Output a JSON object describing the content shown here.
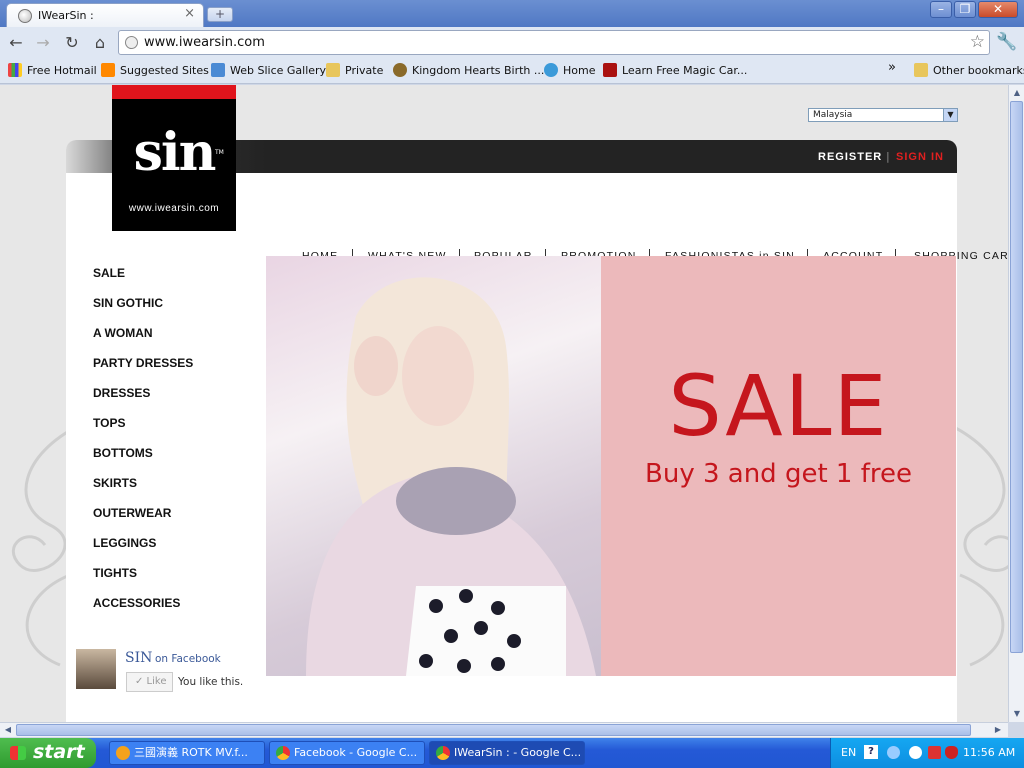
{
  "browser": {
    "tab_title": "IWearSin :",
    "tab_close": "×",
    "new_tab": "+",
    "window_buttons": {
      "minimize": "–",
      "maximize": "❐",
      "close": "✕"
    },
    "nav": {
      "back": "←",
      "forward": "→",
      "reload": "↻",
      "home": "⌂"
    },
    "url": "www.iwearsin.com",
    "star": "☆",
    "wrench": "🔧",
    "bookmarks": [
      {
        "label": "Free Hotmail"
      },
      {
        "label": "Suggested Sites"
      },
      {
        "label": "Web Slice Gallery"
      },
      {
        "label": "Private"
      },
      {
        "label": "Kingdom Hearts Birth ..."
      },
      {
        "label": "Home"
      },
      {
        "label": "Learn Free Magic Car..."
      }
    ],
    "bookmarks_more": "»",
    "other_bookmarks": "Other bookmarks"
  },
  "page": {
    "country_select": {
      "value": "Malaysia",
      "arrow": "▼"
    },
    "auth": {
      "register": "REGISTER",
      "separator": "|",
      "sign_in": "SIGN IN"
    },
    "logo": {
      "word": "sin",
      "tm": "TM",
      "site": "www.iwearsin.com"
    },
    "nav": [
      {
        "label": "HOME"
      },
      {
        "label": "WHAT'S NEW"
      },
      {
        "label": "POPULAR"
      },
      {
        "label": "PROMOTION"
      },
      {
        "label": "FASHIONISTAS in SIN"
      },
      {
        "label": "ACCOUNT"
      },
      {
        "label": "SHOPPING CART"
      }
    ],
    "categories": [
      "SALE",
      "SIN GOTHIC",
      "A WOMAN",
      "PARTY DRESSES",
      "DRESSES",
      "TOPS",
      "BOTTOMS",
      "SKIRTS",
      "OUTERWEAR",
      "LEGGINGS",
      "TIGHTS",
      "ACCESSORIES"
    ],
    "banner": {
      "title": "SALE",
      "subtitle": "Buy 3 and get 1 free"
    },
    "facebook": {
      "name": "SIN",
      "on": "on Facebook",
      "like": "✓ Like",
      "you_like": "You like this."
    }
  },
  "taskbar": {
    "start": "start",
    "tasks": [
      {
        "label": "三國演義 ROTK MV.f..."
      },
      {
        "label": "Facebook - Google C..."
      },
      {
        "label": "IWearSin : - Google C..."
      }
    ],
    "lang": "EN",
    "help": "?",
    "clock": "11:56 AM"
  },
  "colors": {
    "accent_red": "#e02020",
    "sale_red": "#c5161d",
    "banner_pink": "#ecb9bb",
    "fb_blue": "#3b5998"
  }
}
